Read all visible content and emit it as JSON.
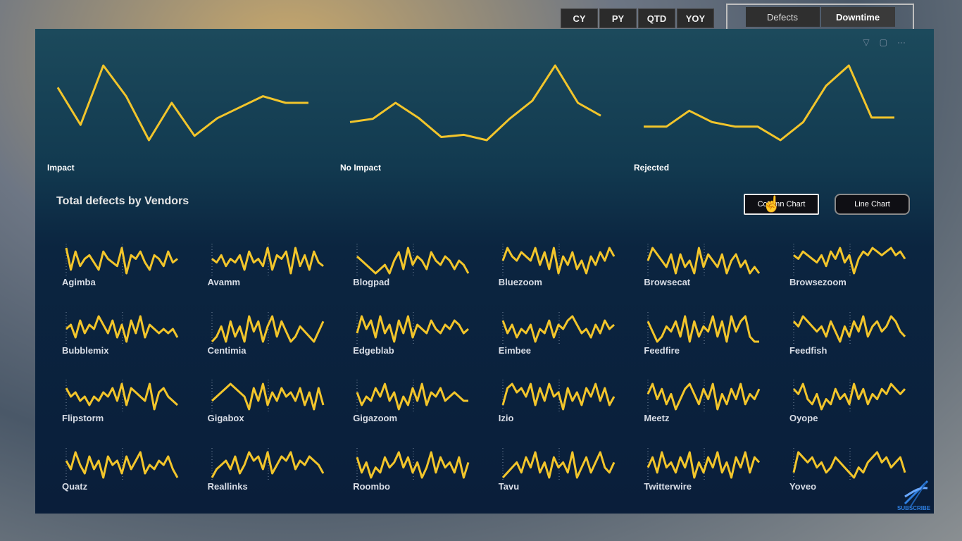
{
  "topbar": {
    "periods": [
      {
        "label": "CY"
      },
      {
        "label": "PY"
      },
      {
        "label": "QTD"
      },
      {
        "label": "YOY"
      }
    ],
    "toggles": [
      {
        "label": "Defects",
        "active": false
      },
      {
        "label": "Downtime",
        "active": true
      }
    ]
  },
  "trends": [
    {
      "label": "Impact",
      "values": [
        62,
        45,
        72,
        58,
        38,
        55,
        40,
        48,
        53,
        58,
        55,
        55
      ]
    },
    {
      "label": "No Impact",
      "values": [
        52,
        55,
        70,
        56,
        38,
        40,
        35,
        55,
        72,
        105,
        70,
        58
      ]
    },
    {
      "label": "Rejected",
      "values": [
        38,
        38,
        45,
        40,
        38,
        38,
        32,
        40,
        56,
        65,
        42,
        42
      ]
    }
  ],
  "section": {
    "title": "Total defects by Vendors"
  },
  "chart_buttons": {
    "column": "Column Chart",
    "line": "Line Chart"
  },
  "colors": {
    "line": "#f2c52b",
    "panel": "#0b2540"
  },
  "vendors": [
    {
      "name": "Agimba",
      "values": [
        9,
        3,
        8,
        4,
        6,
        7,
        5,
        3,
        8,
        6,
        5,
        4,
        9,
        2,
        7,
        6,
        8,
        5,
        3,
        7,
        6,
        4,
        8,
        5,
        6
      ]
    },
    {
      "name": "Avamm",
      "values": [
        6,
        5,
        7,
        4,
        6,
        5,
        7,
        3,
        8,
        5,
        6,
        4,
        9,
        3,
        7,
        6,
        8,
        2,
        9,
        4,
        7,
        3,
        8,
        5,
        4
      ]
    },
    {
      "name": "Blogpad",
      "values": [
        7,
        6,
        5,
        4,
        3,
        4,
        5,
        3,
        6,
        8,
        4,
        9,
        5,
        7,
        6,
        4,
        8,
        6,
        5,
        7,
        6,
        4,
        6,
        5,
        3
      ]
    },
    {
      "name": "Bluezoom",
      "values": [
        6,
        9,
        7,
        6,
        8,
        7,
        6,
        9,
        5,
        8,
        4,
        9,
        3,
        7,
        5,
        8,
        4,
        6,
        3,
        7,
        5,
        8,
        6,
        9,
        7
      ]
    },
    {
      "name": "Browsecat",
      "values": [
        7,
        9,
        8,
        7,
        6,
        8,
        5,
        8,
        6,
        7,
        5,
        9,
        6,
        8,
        7,
        6,
        8,
        5,
        7,
        8,
        6,
        7,
        5,
        6,
        5
      ]
    },
    {
      "name": "Browsezoom",
      "values": [
        7,
        6,
        8,
        7,
        6,
        5,
        7,
        4,
        8,
        6,
        9,
        5,
        7,
        2,
        6,
        8,
        7,
        9,
        8,
        7,
        8,
        9,
        7,
        8,
        6
      ]
    },
    {
      "name": "Bubblemix",
      "values": [
        6,
        7,
        4,
        8,
        5,
        7,
        6,
        9,
        7,
        5,
        8,
        4,
        7,
        3,
        8,
        5,
        9,
        4,
        7,
        6,
        5,
        6,
        5,
        6,
        4
      ]
    },
    {
      "name": "Centimia",
      "values": [
        4,
        5,
        7,
        4,
        8,
        5,
        7,
        4,
        9,
        6,
        8,
        4,
        7,
        9,
        5,
        8,
        6,
        4,
        5,
        7,
        6,
        5,
        4,
        6,
        8
      ]
    },
    {
      "name": "Edgeblab",
      "values": [
        5,
        9,
        6,
        8,
        4,
        9,
        5,
        7,
        3,
        8,
        5,
        9,
        4,
        7,
        6,
        5,
        8,
        6,
        5,
        7,
        6,
        8,
        7,
        5,
        6
      ]
    },
    {
      "name": "Eimbee",
      "values": [
        8,
        5,
        7,
        4,
        6,
        5,
        7,
        3,
        6,
        5,
        8,
        4,
        7,
        6,
        8,
        9,
        7,
        5,
        6,
        4,
        7,
        5,
        8,
        6,
        7
      ]
    },
    {
      "name": "Feedfire",
      "values": [
        8,
        6,
        4,
        5,
        7,
        6,
        8,
        5,
        9,
        4,
        8,
        5,
        7,
        6,
        9,
        5,
        8,
        4,
        9,
        6,
        8,
        9,
        5,
        4,
        4
      ]
    },
    {
      "name": "Feedfish",
      "values": [
        8,
        7,
        9,
        8,
        7,
        6,
        7,
        5,
        8,
        6,
        4,
        7,
        5,
        8,
        6,
        9,
        5,
        7,
        8,
        6,
        7,
        9,
        8,
        6,
        5
      ]
    },
    {
      "name": "Flipstorm",
      "values": [
        8,
        6,
        7,
        5,
        6,
        4,
        6,
        5,
        7,
        6,
        8,
        5,
        9,
        4,
        8,
        7,
        6,
        5,
        9,
        3,
        7,
        8,
        6,
        5,
        4
      ]
    },
    {
      "name": "Gigabox",
      "values": [
        5,
        6,
        7,
        8,
        9,
        8,
        7,
        6,
        3,
        8,
        5,
        9,
        4,
        7,
        5,
        8,
        6,
        7,
        5,
        8,
        4,
        7,
        3,
        8,
        4
      ]
    },
    {
      "name": "Gigazoom",
      "values": [
        7,
        4,
        6,
        5,
        8,
        6,
        9,
        5,
        7,
        3,
        6,
        4,
        8,
        5,
        9,
        4,
        7,
        6,
        8,
        5,
        6,
        7,
        6,
        5,
        5
      ]
    },
    {
      "name": "Izio",
      "values": [
        4,
        8,
        9,
        7,
        8,
        6,
        9,
        4,
        8,
        5,
        9,
        6,
        7,
        3,
        8,
        5,
        7,
        4,
        8,
        6,
        9,
        5,
        8,
        4,
        6
      ]
    },
    {
      "name": "Meetz",
      "values": [
        7,
        9,
        6,
        8,
        5,
        7,
        4,
        6,
        8,
        9,
        7,
        5,
        8,
        6,
        9,
        4,
        7,
        5,
        8,
        6,
        9,
        5,
        7,
        6,
        8
      ]
    },
    {
      "name": "Oyope",
      "values": [
        8,
        7,
        9,
        6,
        5,
        7,
        4,
        6,
        5,
        8,
        6,
        7,
        5,
        9,
        6,
        8,
        5,
        7,
        6,
        8,
        7,
        9,
        8,
        7,
        8
      ]
    },
    {
      "name": "Quatz",
      "values": [
        7,
        5,
        9,
        6,
        4,
        8,
        5,
        7,
        3,
        8,
        6,
        7,
        4,
        8,
        5,
        7,
        9,
        4,
        6,
        5,
        7,
        6,
        8,
        5,
        3
      ]
    },
    {
      "name": "Reallinks",
      "values": [
        3,
        5,
        6,
        7,
        5,
        8,
        4,
        6,
        9,
        7,
        8,
        5,
        9,
        4,
        6,
        8,
        7,
        9,
        5,
        7,
        6,
        8,
        7,
        6,
        4
      ]
    },
    {
      "name": "Roombo",
      "values": [
        8,
        5,
        7,
        4,
        6,
        5,
        8,
        6,
        7,
        9,
        6,
        8,
        5,
        7,
        4,
        6,
        9,
        5,
        8,
        6,
        7,
        5,
        8,
        4,
        7
      ]
    },
    {
      "name": "Tavu",
      "values": [
        4,
        5,
        6,
        7,
        5,
        8,
        6,
        9,
        5,
        7,
        4,
        8,
        6,
        7,
        5,
        9,
        4,
        6,
        8,
        5,
        7,
        9,
        6,
        5,
        7
      ]
    },
    {
      "name": "Twitterwire",
      "values": [
        6,
        8,
        5,
        9,
        6,
        7,
        5,
        8,
        6,
        9,
        4,
        7,
        5,
        8,
        6,
        9,
        5,
        7,
        4,
        8,
        6,
        9,
        5,
        8,
        7
      ]
    },
    {
      "name": "Yoveo",
      "values": [
        5,
        9,
        8,
        7,
        8,
        6,
        7,
        5,
        6,
        8,
        7,
        6,
        5,
        4,
        6,
        5,
        7,
        8,
        9,
        7,
        8,
        6,
        7,
        8,
        5
      ]
    }
  ]
}
